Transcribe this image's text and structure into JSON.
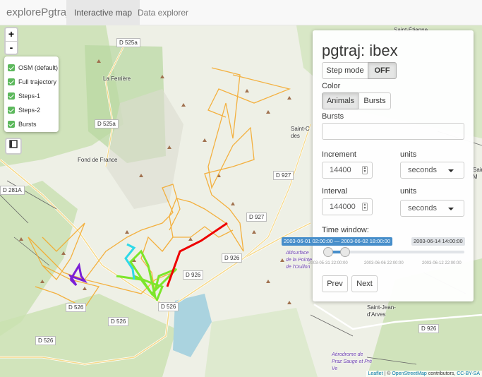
{
  "navbar": {
    "brand": "explorePgtraj",
    "tabs": [
      {
        "label": "Interactive map",
        "active": true
      },
      {
        "label": "Data explorer",
        "active": false
      }
    ]
  },
  "map": {
    "zoom_in": "+",
    "zoom_out": "-",
    "layers": [
      {
        "label": "OSM (default)",
        "checked": true
      },
      {
        "label": "Full trajectory",
        "checked": true
      },
      {
        "label": "Steps-1",
        "checked": true
      },
      {
        "label": "Steps-2",
        "checked": true
      },
      {
        "label": "Bursts",
        "checked": true
      }
    ],
    "layers_toggle_icon": "layers-icon",
    "road_labels": [
      "D 525a",
      "D 525a",
      "D 927",
      "D 927",
      "D 926",
      "D 526",
      "D 526",
      "D 526",
      "D 926",
      "D 526",
      "D 926",
      "D 281A"
    ],
    "place_labels": [
      "La Ferrière",
      "Fond de France",
      "Saint-C des",
      "Saint-Étienne",
      "Saint-Jean-d'Arves",
      "Aérodrome de Praz Sauge et Pré Ve",
      "Altisurface de la Pointe de l'Ouillon",
      "Saint-M"
    ],
    "attribution": {
      "leaflet": "Leaflet",
      "sep": " | © ",
      "osm": "OpenStreetMap",
      "rest": " contributors, ",
      "license": "CC-BY-SA"
    }
  },
  "panel": {
    "title": "pgtraj: ibex",
    "step_mode": {
      "label": "Step mode",
      "value": "OFF"
    },
    "color": {
      "label": "Color",
      "options": [
        "Animals",
        "Bursts"
      ],
      "selected": "Animals"
    },
    "bursts": {
      "label": "Bursts",
      "value": ""
    },
    "increment": {
      "label": "Increment",
      "value": "14400",
      "units_label": "units",
      "units_value": "seconds"
    },
    "interval": {
      "label": "Interval",
      "value": "144000",
      "units_label": "units",
      "units_value": "seconds"
    },
    "time_window": {
      "label": "Time window:",
      "range_label": "2003-06-01 02:00:00 — 2003-06-02 18:00:00",
      "max_label": "2003-06-14 14:00:00",
      "ticks": [
        "2003-05-31 22:00:00",
        "2003-06-06 22:00:00",
        "2003-06-12 22:00:00"
      ],
      "range_start_fraction": 0.0,
      "range_end_fraction": 0.12
    },
    "prev_label": "Prev",
    "next_label": "Next"
  },
  "colors": {
    "trajectory": "#f5a623",
    "burst_red": "#ee0000",
    "burst_green": "#7ce62b",
    "burst_cyan": "#2fd9e8",
    "burst_purple": "#7b1fd6",
    "accent": "#428bca"
  }
}
